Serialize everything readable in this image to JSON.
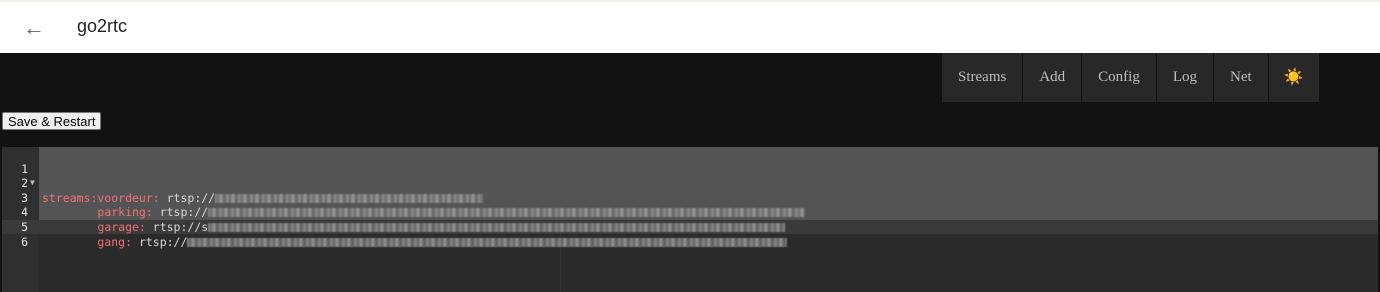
{
  "header": {
    "title": "go2rtc"
  },
  "nav": {
    "items": [
      "Streams",
      "Add",
      "Config",
      "Log",
      "Net"
    ],
    "theme_icon": "☀️"
  },
  "toolbar": {
    "save_label": "Save & Restart"
  },
  "editor": {
    "lines": [
      {
        "num": "1",
        "key": "streams:",
        "val": "",
        "indent": ""
      },
      {
        "num": "2",
        "key": "voordeur:",
        "val": " rtsp://",
        "indent": "        "
      },
      {
        "num": "3",
        "key": "parking:",
        "val": " rtsp://",
        "indent": "        "
      },
      {
        "num": "4",
        "key": "garage:",
        "val": " rtsp://s",
        "indent": "        "
      },
      {
        "num": "5",
        "key": "gang:",
        "val": " rtsp://",
        "indent": "        "
      },
      {
        "num": "6",
        "key": "",
        "val": "",
        "indent": ""
      }
    ]
  }
}
